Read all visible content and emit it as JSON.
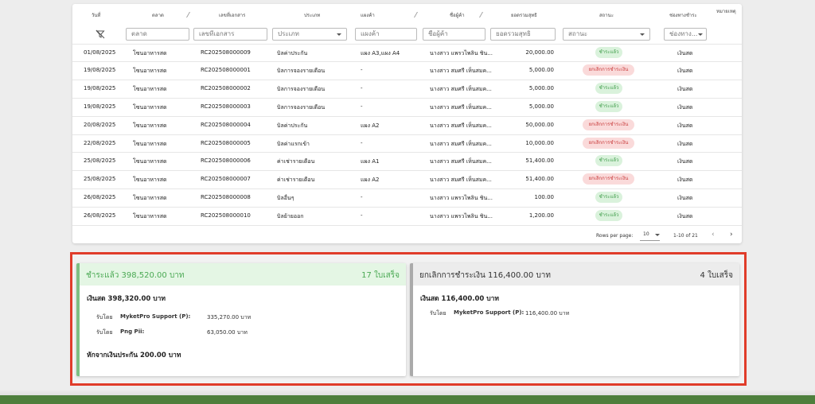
{
  "table": {
    "headers": [
      "วันที่",
      "ตลาด",
      "เลขที่เอกสาร",
      "ประเภท",
      "แผงค้า",
      "ชื่อผู้ค้า",
      "ยอดรวมสุทธิ",
      "สถานะ",
      "ช่องทางชำระ",
      "หมายเหตุ"
    ],
    "filters": {
      "market": "ตลาด",
      "doc_no": "เลขที่เอกสาร",
      "type": "ประเภท",
      "stall": "แผงค้า",
      "vendor": "ชื่อผู้ค้า",
      "total": "ยอดรวมสุทธิ",
      "status": "สถานะ",
      "channel": "ช่องทาง..."
    },
    "rows": [
      {
        "date": "01/08/2025",
        "market": "โซนอาหารสด",
        "doc": "RC202508000009",
        "type": "บิลค่าประกัน",
        "stall": "แผง A3,แผง A4",
        "vendor": "นางสาว แพรวไพลิน ชิน...",
        "total": "20,000.00",
        "status": "ชำระแล้ว",
        "status_kind": "paid",
        "channel": "เงินสด"
      },
      {
        "date": "19/08/2025",
        "market": "โซนอาหารสด",
        "doc": "RC202508000001",
        "type": "บิลการจองรายเดือน",
        "stall": "-",
        "vendor": "นางสาว สมศรี เห็นสมค...",
        "total": "5,000.00",
        "status": "ยกเลิกการชำระเงิน",
        "status_kind": "cancel",
        "channel": "เงินสด"
      },
      {
        "date": "19/08/2025",
        "market": "โซนอาหารสด",
        "doc": "RC202508000002",
        "type": "บิลการจองรายเดือน",
        "stall": "-",
        "vendor": "นางสาว สมศรี เห็นสมค...",
        "total": "5,000.00",
        "status": "ชำระแล้ว",
        "status_kind": "paid",
        "channel": "เงินสด"
      },
      {
        "date": "19/08/2025",
        "market": "โซนอาหารสด",
        "doc": "RC202508000003",
        "type": "บิลการจองรายเดือน",
        "stall": "-",
        "vendor": "นางสาว สมศรี เห็นสมค...",
        "total": "5,000.00",
        "status": "ชำระแล้ว",
        "status_kind": "paid",
        "channel": "เงินสด"
      },
      {
        "date": "20/08/2025",
        "market": "โซนอาหารสด",
        "doc": "RC202508000004",
        "type": "บิลค่าประกัน",
        "stall": "แผง A2",
        "vendor": "นางสาว สมศรี เห็นสมค...",
        "total": "50,000.00",
        "status": "ยกเลิกการชำระเงิน",
        "status_kind": "cancel",
        "channel": "เงินสด"
      },
      {
        "date": "22/08/2025",
        "market": "โซนอาหารสด",
        "doc": "RC202508000005",
        "type": "บิลค่าแรกเข้า",
        "stall": "-",
        "vendor": "นางสาว สมศรี เห็นสมค...",
        "total": "10,000.00",
        "status": "ยกเลิกการชำระเงิน",
        "status_kind": "cancel",
        "channel": "เงินสด"
      },
      {
        "date": "25/08/2025",
        "market": "โซนอาหารสด",
        "doc": "RC202508000006",
        "type": "ค่าเช่ารายเดือน",
        "stall": "แผง A1",
        "vendor": "นางสาว สมศรี เห็นสมค...",
        "total": "51,400.00",
        "status": "ชำระแล้ว",
        "status_kind": "paid",
        "channel": "เงินสด"
      },
      {
        "date": "25/08/2025",
        "market": "โซนอาหารสด",
        "doc": "RC202508000007",
        "type": "ค่าเช่ารายเดือน",
        "stall": "แผง A2",
        "vendor": "นางสาว สมศรี เห็นสมค...",
        "total": "51,400.00",
        "status": "ยกเลิกการชำระเงิน",
        "status_kind": "cancel",
        "channel": "เงินสด"
      },
      {
        "date": "26/08/2025",
        "market": "โซนอาหารสด",
        "doc": "RC202508000008",
        "type": "บิลอื่นๆ",
        "stall": "-",
        "vendor": "นางสาว แพรวไพลิน ชิน...",
        "total": "100.00",
        "status": "ชำระแล้ว",
        "status_kind": "paid",
        "channel": "เงินสด"
      },
      {
        "date": "26/08/2025",
        "market": "โซนอาหารสด",
        "doc": "RC202508000010",
        "type": "บิลย้ายออก",
        "stall": "-",
        "vendor": "นางสาว แพรวไพลิน ชิน...",
        "total": "1,200.00",
        "status": "ชำระแล้ว",
        "status_kind": "paid",
        "channel": "เงินสด"
      }
    ],
    "pagination": {
      "rows_per_page_label": "Rows per page:",
      "rows_per_page": "10",
      "range": "1-10 of 21"
    }
  },
  "summary": {
    "paid": {
      "title": "ชำระแล้ว 398,520.00 บาท",
      "count": "17 ใบเสร็จ",
      "method": "เงินสด 398,320.00 บาท",
      "received": [
        {
          "label": "รับโดย",
          "who": "MyketPro Support (P):",
          "amount": "335,270.00 บาท"
        },
        {
          "label": "รับโดย",
          "who": "Png Pii:",
          "amount": "63,050.00 บาท"
        }
      ],
      "deduct": "หักจากเงินประกัน 200.00 บาท"
    },
    "cancel": {
      "title": "ยกเลิกการชำระเงิน 116,400.00 บาท",
      "count": "4 ใบเสร็จ",
      "method": "เงินสด 116,400.00 บาท",
      "received": [
        {
          "label": "รับโดย",
          "who": "MyketPro Support (P):",
          "amount": "116,400.00 บาท"
        }
      ]
    }
  },
  "colors": {
    "paid_accent": "#4aa953",
    "cancel_accent": "#c83a3a",
    "highlight_frame": "#e03c2a"
  }
}
